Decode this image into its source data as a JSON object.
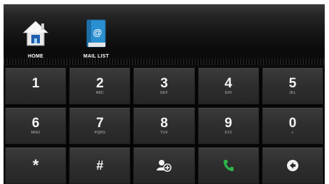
{
  "nav": {
    "home_label": "HOME",
    "mail_list_label": "MAIL LIST"
  },
  "keypad": {
    "keys": [
      {
        "digit": "1",
        "letters": ""
      },
      {
        "digit": "2",
        "letters": "ABC"
      },
      {
        "digit": "3",
        "letters": "DEF"
      },
      {
        "digit": "4",
        "letters": "GHI"
      },
      {
        "digit": "5",
        "letters": "JKL"
      },
      {
        "digit": "6",
        "letters": "MNO"
      },
      {
        "digit": "7",
        "letters": "PQRS"
      },
      {
        "digit": "8",
        "letters": "TUV"
      },
      {
        "digit": "9",
        "letters": "XYZ"
      },
      {
        "digit": "0",
        "letters": "+"
      }
    ],
    "star": "*",
    "hash": "#",
    "add_contact_icon": "add-contact-icon",
    "call_icon": "phone-call-icon",
    "back_icon": "backspace-icon"
  },
  "colors": {
    "call_green": "#2fb34a",
    "mail_icon_blue": "#2a8fd0",
    "home_icon_blue": "#1f5fb0"
  }
}
